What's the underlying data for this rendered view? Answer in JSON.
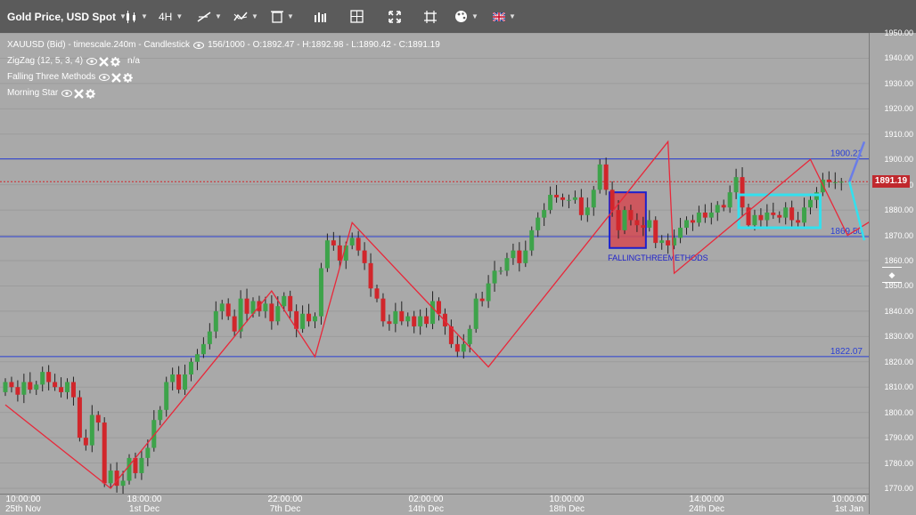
{
  "toolbar": {
    "symbol_label": "Gold Price, USD Spot",
    "timeframe_label": "4H",
    "icons": [
      "candlestick-chart-icon",
      "timeframe-dropdown",
      "drawing-line-icon",
      "indicator-icon",
      "trash-icon",
      "bar-chart-icon",
      "crosshair-layout-icon",
      "fullscreen-expand-icon",
      "fit-screen-icon",
      "palette-icon",
      "uk-flag-icon"
    ]
  },
  "legend": {
    "main": "XAUUSD (Bid) - timescale.240m - Candlestick",
    "main_values": "156/1000 - O:1892.47 - H:1892.98 - L:1890.42 - C:1891.19",
    "zigzag": "ZigZag (12, 5, 3, 4)",
    "zigzag_value": "n/a",
    "falling": "Falling Three Methods",
    "morning": "Morning Star"
  },
  "y_ticks": [
    "1950.00",
    "1940.00",
    "1930.00",
    "1920.00",
    "1910.00",
    "1900.00",
    "1890.00",
    "1880.00",
    "1870.00",
    "1860.00",
    "1850.00",
    "1840.00",
    "1830.00",
    "1820.00",
    "1810.00",
    "1800.00",
    "1790.00",
    "1780.00",
    "1770.00"
  ],
  "x_ticks": [
    {
      "time": "10:00:00",
      "date": "25th Nov"
    },
    {
      "time": "18:00:00",
      "date": "1st Dec"
    },
    {
      "time": "22:00:00",
      "date": "7th Dec"
    },
    {
      "time": "02:00:00",
      "date": "14th Dec"
    },
    {
      "time": "10:00:00",
      "date": "18th Dec"
    },
    {
      "time": "14:00:00",
      "date": "24th Dec"
    },
    {
      "time": "10:00:00",
      "date": "1st Jan"
    }
  ],
  "price_badge": "1891.19",
  "levels": {
    "top": "1900.21",
    "mid": "1869.50",
    "low": "1822.07"
  },
  "pattern_label": "FALLINGTHREEMETHODS",
  "colors": {
    "bull": "#3da34a",
    "bear": "#d1262b",
    "zigzag": "#e8283a",
    "level": "#2a3fd4",
    "pattern_fill": "#d44a52",
    "pattern_border": "#1d1fcc",
    "morning_box": "#33e0ee"
  },
  "chart_data": {
    "type": "candlestick",
    "ylim": [
      1768,
      1952
    ],
    "open": [
      1808,
      1812,
      1810,
      1807,
      1812,
      1809,
      1811,
      1816,
      1812,
      1810,
      1808,
      1812,
      1806,
      1790,
      1787,
      1799,
      1796,
      1772,
      1777,
      1771,
      1773,
      1782,
      1776,
      1782,
      1786,
      1797,
      1801,
      1812,
      1815,
      1809,
      1815,
      1820,
      1823,
      1827,
      1832,
      1840,
      1843,
      1838,
      1832,
      1845,
      1839,
      1844,
      1840,
      1843,
      1836,
      1842,
      1846,
      1840,
      1833,
      1839,
      1836,
      1838,
      1857,
      1868,
      1866,
      1860,
      1866,
      1869,
      1864,
      1859,
      1849,
      1845,
      1836,
      1835,
      1840,
      1836,
      1838,
      1834,
      1838,
      1835,
      1844,
      1839,
      1834,
      1827,
      1824,
      1827,
      1833,
      1845,
      1844,
      1851,
      1856,
      1856,
      1861,
      1864,
      1859,
      1864,
      1872,
      1877,
      1880,
      1886,
      1885,
      1884,
      1884,
      1885,
      1878,
      1881,
      1888,
      1898,
      1888,
      1880,
      1872,
      1880,
      1876,
      1874,
      1873,
      1876,
      1867,
      1868,
      1866,
      1869,
      1873,
      1876,
      1875,
      1879,
      1877,
      1879,
      1882,
      1881,
      1887,
      1893,
      1881,
      1874,
      1878,
      1876,
      1879,
      1878,
      1877,
      1881,
      1876,
      1875,
      1881,
      1884,
      1887,
      1892,
      1891,
      1891
    ],
    "close": [
      1812,
      1810,
      1807,
      1812,
      1809,
      1811,
      1816,
      1812,
      1810,
      1808,
      1812,
      1806,
      1790,
      1787,
      1799,
      1796,
      1772,
      1777,
      1771,
      1773,
      1782,
      1776,
      1782,
      1786,
      1797,
      1801,
      1812,
      1815,
      1809,
      1815,
      1820,
      1823,
      1827,
      1832,
      1840,
      1843,
      1838,
      1832,
      1845,
      1839,
      1844,
      1840,
      1843,
      1836,
      1842,
      1846,
      1840,
      1833,
      1839,
      1836,
      1838,
      1857,
      1868,
      1866,
      1860,
      1866,
      1869,
      1864,
      1859,
      1849,
      1845,
      1836,
      1835,
      1840,
      1836,
      1838,
      1834,
      1838,
      1835,
      1844,
      1839,
      1834,
      1827,
      1824,
      1827,
      1833,
      1845,
      1844,
      1851,
      1856,
      1856,
      1861,
      1864,
      1859,
      1864,
      1872,
      1877,
      1880,
      1886,
      1885,
      1884,
      1884,
      1885,
      1878,
      1881,
      1888,
      1898,
      1888,
      1880,
      1872,
      1880,
      1876,
      1874,
      1873,
      1876,
      1867,
      1868,
      1866,
      1869,
      1873,
      1876,
      1875,
      1879,
      1877,
      1879,
      1882,
      1881,
      1887,
      1893,
      1881,
      1874,
      1878,
      1876,
      1879,
      1878,
      1877,
      1881,
      1876,
      1875,
      1881,
      1884,
      1887,
      1892,
      1891,
      1891,
      1891.19
    ],
    "zigzag": [
      [
        0,
        1803
      ],
      [
        17,
        1770
      ],
      [
        43,
        1848
      ],
      [
        50,
        1822
      ],
      [
        56,
        1875
      ],
      [
        78,
        1818
      ],
      [
        107,
        1907
      ],
      [
        108,
        1855
      ],
      [
        130,
        1900
      ],
      [
        136,
        1870
      ],
      [
        156,
        1900
      ]
    ]
  }
}
